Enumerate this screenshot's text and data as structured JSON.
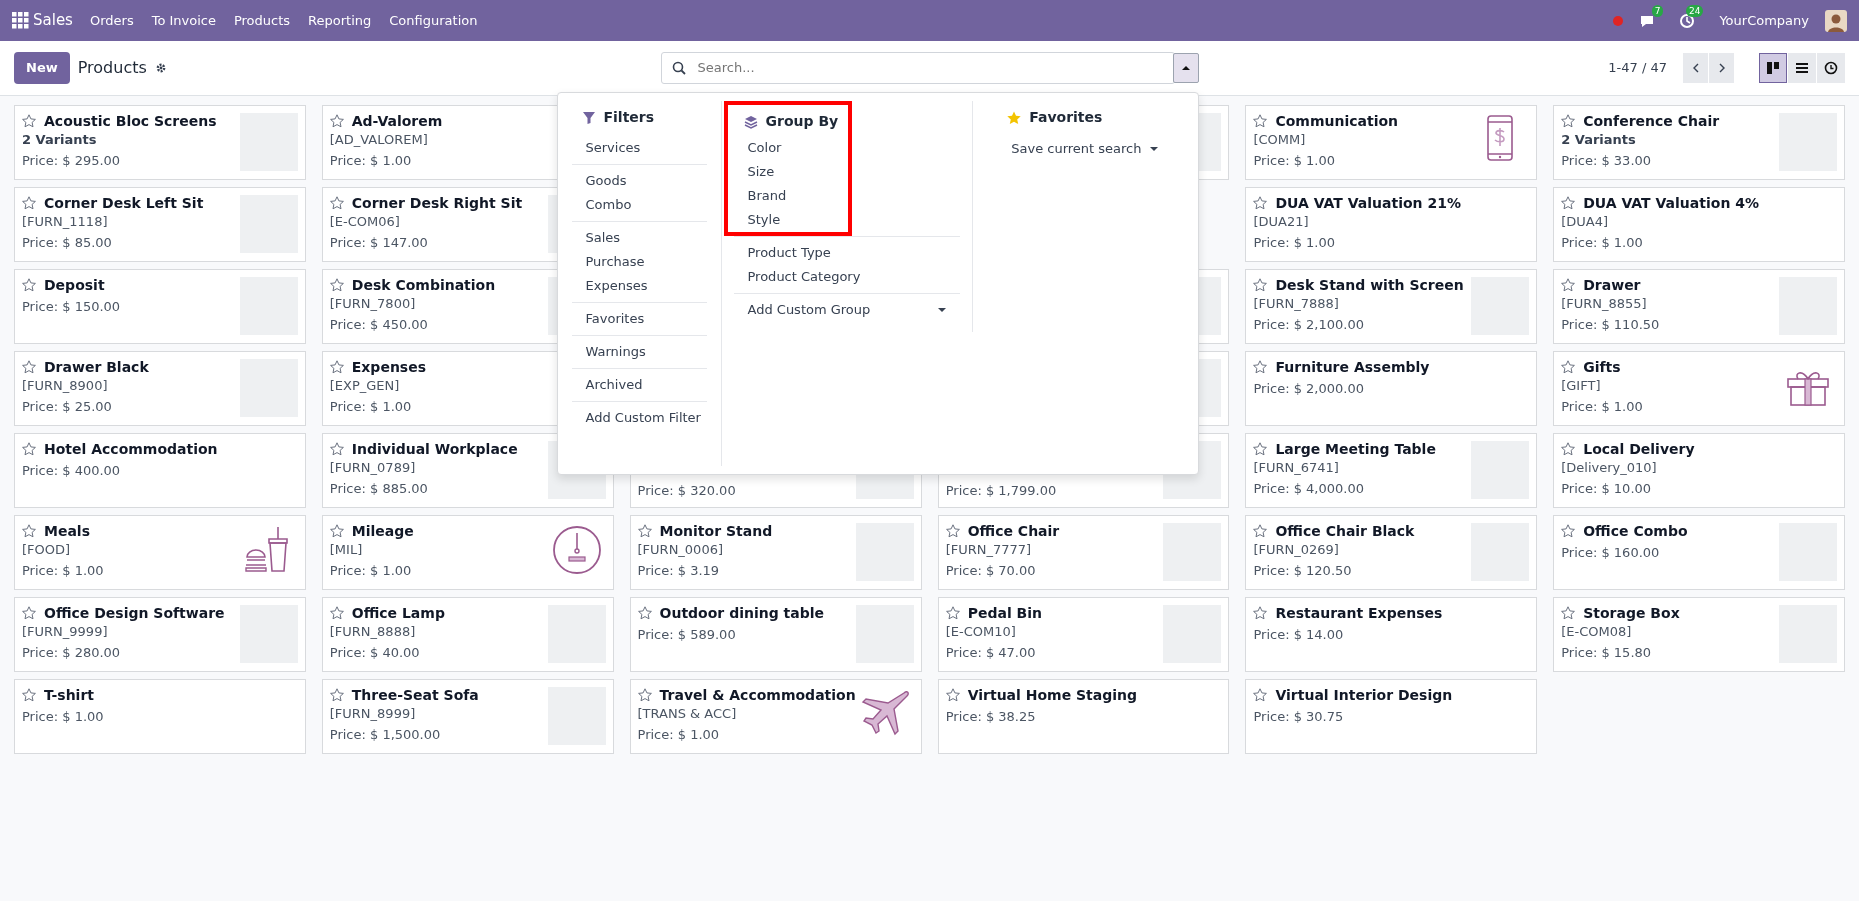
{
  "navbar": {
    "app_name": "Sales",
    "menu": [
      "Orders",
      "To Invoice",
      "Products",
      "Reporting",
      "Configuration"
    ],
    "chat_count": "7",
    "activity_count": "24",
    "company": "YourCompany"
  },
  "control_panel": {
    "new_button": "New",
    "title": "Products",
    "search": {
      "placeholder": "Search..."
    },
    "search_panel_open": true,
    "pager": "1-47 / 47",
    "views": [
      {
        "kind": "kanban",
        "selected": true
      },
      {
        "kind": "list",
        "selected": false
      },
      {
        "kind": "activity",
        "selected": false
      }
    ]
  },
  "search_panel": {
    "filters": {
      "title": "Filters",
      "groups": [
        [
          "Services"
        ],
        [
          "Goods",
          "Combo"
        ],
        [
          "Sales",
          "Purchase",
          "Expenses"
        ],
        [
          "Favorites"
        ],
        [
          "Warnings"
        ],
        [
          "Archived"
        ],
        [
          "Add Custom Filter"
        ]
      ]
    },
    "group_by": {
      "title": "Group By",
      "groups": [
        {
          "kind": "options",
          "highlighted": true,
          "items": [
            "Color",
            "Size",
            "Brand",
            "Style"
          ]
        },
        {
          "kind": "options",
          "highlighted": false,
          "items": [
            "Product Type",
            "Product Category"
          ]
        },
        {
          "kind": "select",
          "highlighted": false,
          "items": [
            "Add Custom Group"
          ]
        }
      ]
    },
    "favorites": {
      "title": "Favorites",
      "items": [
        "Save current search"
      ]
    }
  },
  "cards": [
    {
      "name": "Acoustic Bloc Screens",
      "favorite": false,
      "variants": "2 Variants",
      "price": "Price: $ 295.00",
      "image": {
        "kind": "photo"
      }
    },
    {
      "name": "Ad-Valorem",
      "favorite": false,
      "code": "[AD_VALOREM]",
      "price": "Price: $ 1.00"
    },
    {
      "image": {
        "kind": "photo"
      }
    },
    {
      "name": "Communication",
      "favorite": false,
      "code": "[COMM]",
      "price": "Price: $ 1.00",
      "image": {
        "kind": "phone"
      }
    },
    {
      "name": "Conference Chair",
      "favorite": false,
      "variants": "2 Variants",
      "price": "Price: $ 33.00",
      "image": {
        "kind": "photo"
      }
    },
    {
      "name": "Corner Desk Left Sit",
      "favorite": false,
      "code": "[FURN_1118]",
      "price": "Price: $ 85.00",
      "image": {
        "kind": "photo"
      }
    },
    {
      "name": "Corner Desk Right Sit",
      "favorite": false,
      "code": "[E-COM06]",
      "price": "Price: $ 147.00",
      "image": {
        "kind": "photo"
      }
    },
    {
      "name": "DUA VAT Valuation 21%",
      "favorite": false,
      "code": "[DUA21]",
      "price": "Price: $ 1.00"
    },
    {
      "name": "DUA VAT Valuation 4%",
      "favorite": false,
      "code": "[DUA4]",
      "price": "Price: $ 1.00"
    },
    {
      "name": "Deposit",
      "favorite": false,
      "price": "Price: $ 150.00",
      "image": {
        "kind": "photo"
      }
    },
    {
      "name": "Desk Combination",
      "favorite": false,
      "code": "[FURN_7800]",
      "price": "Price: $ 450.00",
      "image": {
        "kind": "photo"
      }
    },
    {
      "image": {
        "kind": "photo"
      }
    },
    {
      "name": "Desk Stand with Screen",
      "favorite": false,
      "code": "[FURN_7888]",
      "price": "Price: $ 2,100.00",
      "image": {
        "kind": "photo"
      }
    },
    {
      "name": "Drawer",
      "favorite": false,
      "code": "[FURN_8855]",
      "price": "Price: $ 110.50",
      "image": {
        "kind": "photo"
      }
    },
    {
      "name": "Drawer Black",
      "favorite": false,
      "code": "[FURN_8900]",
      "price": "Price: $ 25.00",
      "image": {
        "kind": "photo"
      }
    },
    {
      "name": "Expenses",
      "favorite": false,
      "code": "[EXP_GEN]",
      "price": "Price: $ 1.00"
    },
    {
      "image": {
        "kind": "photo"
      }
    },
    {
      "name": "Furniture Assembly",
      "favorite": false,
      "price": "Price: $ 2,000.00"
    },
    {
      "name": "Gifts",
      "favorite": false,
      "code": "[GIFT]",
      "price": "Price: $ 1.00",
      "image": {
        "kind": "gift"
      }
    },
    {
      "name": "Hotel Accommodation",
      "favorite": false,
      "price": "Price: $ 400.00"
    },
    {
      "name": "Individual Workplace",
      "favorite": false,
      "code": "[FURN_0789]",
      "price": "Price: $ 885.00",
      "image": {
        "kind": "photo"
      }
    },
    {
      "price": "Price: $ 320.00",
      "image": {
        "kind": "photo"
      }
    },
    {
      "price": "Price: $ 1,799.00",
      "image": {
        "kind": "photo"
      }
    },
    {
      "name": "Large Meeting Table",
      "favorite": false,
      "code": "[FURN_6741]",
      "price": "Price: $ 4,000.00",
      "image": {
        "kind": "photo"
      }
    },
    {
      "name": "Local Delivery",
      "favorite": false,
      "code": "[Delivery_010]",
      "price": "Price: $ 10.00"
    },
    {
      "name": "Meals",
      "favorite": false,
      "code": "[FOOD]",
      "price": "Price: $ 1.00",
      "image": {
        "kind": "meal"
      }
    },
    {
      "name": "Mileage",
      "favorite": false,
      "code": "[MIL]",
      "price": "Price: $ 1.00",
      "image": {
        "kind": "gauge"
      }
    },
    {
      "name": "Monitor Stand",
      "favorite": false,
      "code": "[FURN_0006]",
      "price": "Price: $ 3.19",
      "image": {
        "kind": "photo"
      }
    },
    {
      "name": "Office Chair",
      "favorite": false,
      "code": "[FURN_7777]",
      "price": "Price: $ 70.00",
      "image": {
        "kind": "photo"
      }
    },
    {
      "name": "Office Chair Black",
      "favorite": false,
      "code": "[FURN_0269]",
      "price": "Price: $ 120.50",
      "image": {
        "kind": "photo"
      }
    },
    {
      "name": "Office Combo",
      "favorite": false,
      "price": "Price: $ 160.00",
      "image": {
        "kind": "photo"
      }
    },
    {
      "name": "Office Design Software",
      "favorite": false,
      "code": "[FURN_9999]",
      "price": "Price: $ 280.00",
      "image": {
        "kind": "photo"
      }
    },
    {
      "name": "Office Lamp",
      "favorite": false,
      "code": "[FURN_8888]",
      "price": "Price: $ 40.00",
      "image": {
        "kind": "photo"
      }
    },
    {
      "name": "Outdoor dining table",
      "favorite": false,
      "price": "Price: $ 589.00",
      "image": {
        "kind": "photo"
      }
    },
    {
      "name": "Pedal Bin",
      "favorite": false,
      "code": "[E-COM10]",
      "price": "Price: $ 47.00",
      "image": {
        "kind": "photo"
      }
    },
    {
      "name": "Restaurant Expenses",
      "favorite": false,
      "price": "Price: $ 14.00"
    },
    {
      "name": "Storage Box",
      "favorite": false,
      "code": "[E-COM08]",
      "price": "Price: $ 15.80",
      "image": {
        "kind": "photo"
      }
    },
    {
      "name": "T-shirt",
      "favorite": false,
      "price": "Price: $ 1.00"
    },
    {
      "name": "Three-Seat Sofa",
      "favorite": false,
      "code": "[FURN_8999]",
      "price": "Price: $ 1,500.00",
      "image": {
        "kind": "photo"
      }
    },
    {
      "name": "Travel & Accommodation",
      "favorite": false,
      "code": "[TRANS & ACC]",
      "price": "Price: $ 1.00",
      "image": {
        "kind": "plane"
      }
    },
    {
      "name": "Virtual Home Staging",
      "favorite": false,
      "price": "Price: $ 38.25"
    },
    {
      "name": "Virtual Interior Design",
      "favorite": false,
      "price": "Price: $ 30.75"
    }
  ]
}
